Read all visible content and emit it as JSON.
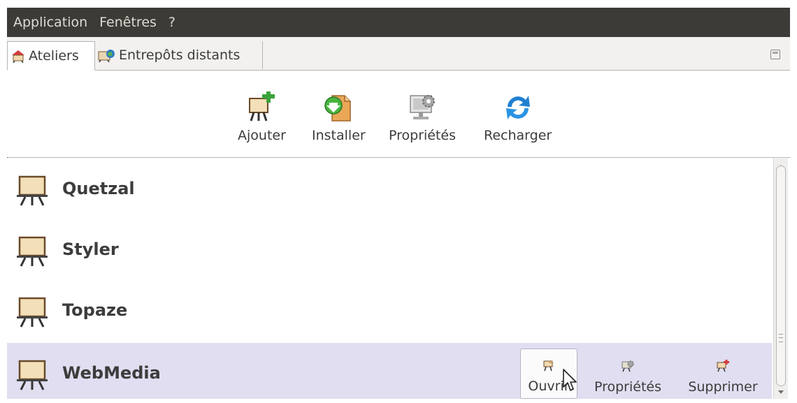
{
  "menu": [
    "Application",
    "Fenêtres",
    "?"
  ],
  "tabs": [
    {
      "label": "Ateliers",
      "icon": "workshop-tab-icon",
      "active": true
    },
    {
      "label": "Entrepôts distants",
      "icon": "remote-repo-tab-icon",
      "active": false
    }
  ],
  "toolbar": {
    "add_label": "Ajouter",
    "install_label": "Installer",
    "properties_label": "Propriétés",
    "reload_label": "Recharger"
  },
  "workshops": [
    {
      "name": "Quetzal"
    },
    {
      "name": "Styler"
    },
    {
      "name": "Topaze"
    },
    {
      "name": "WebMedia"
    }
  ],
  "row_actions": {
    "open_label": "Ouvrir",
    "properties_label": "Propriétés",
    "delete_label": "Supprimer"
  },
  "colors": {
    "menubar": "#3c3b37",
    "hover_row": "#e0def0",
    "add_green": "#3aa33a",
    "reload_blue": "#1f7fd1"
  }
}
